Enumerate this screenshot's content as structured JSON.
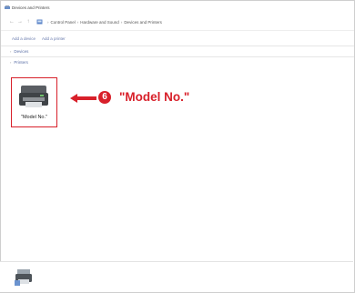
{
  "window": {
    "title": "Devices and Printers"
  },
  "nav": {
    "back": "←",
    "forward": "→",
    "up": "↑",
    "breadcrumb": [
      "Control Panel",
      "Hardware and Sound",
      "Devices and Printers"
    ],
    "separator": "›"
  },
  "commands": {
    "add_device": "Add a device",
    "add_printer": "Add a printer"
  },
  "groups": {
    "devices": "Devices",
    "printers": "Printers",
    "chevron": "›"
  },
  "printer": {
    "label": "\"Model No.\""
  },
  "callout": {
    "number": "6",
    "text": "\"Model No.\""
  },
  "colors": {
    "accent": "#d8202a",
    "link": "#5b6fa6"
  }
}
